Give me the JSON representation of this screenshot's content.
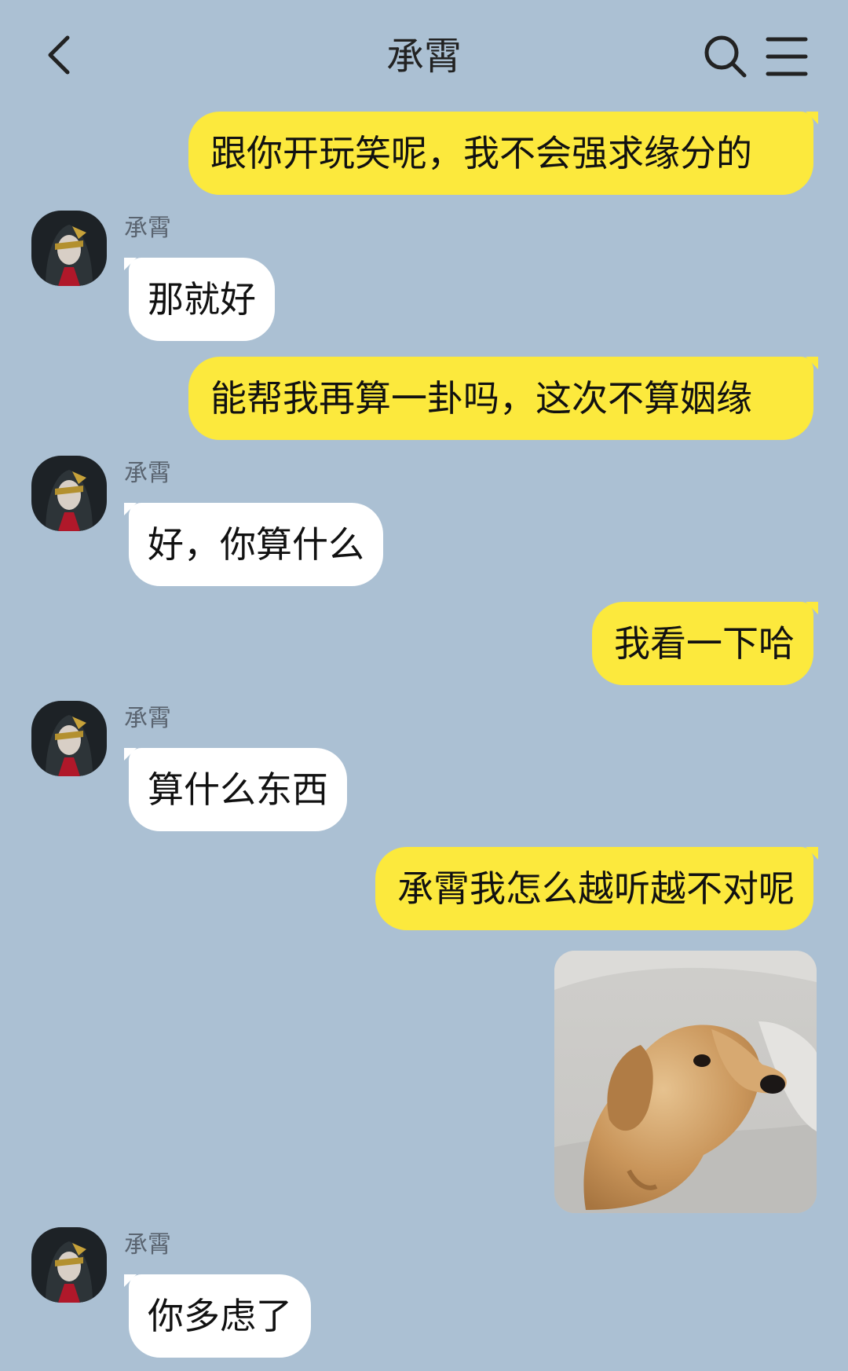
{
  "header": {
    "title": "承霄",
    "back_icon": "chevron-left-icon",
    "search_icon": "search-icon",
    "menu_icon": "menu-icon"
  },
  "colors": {
    "background": "#abc0d3",
    "outgoing_bubble": "#fce93d",
    "incoming_bubble": "#ffffff"
  },
  "messages": [
    {
      "direction": "out",
      "text": "跟你开玩笑呢，我不会强求缘分的"
    },
    {
      "direction": "in",
      "sender": "承霄",
      "text": "那就好"
    },
    {
      "direction": "out",
      "text": "能帮我再算一卦吗，这次不算姻缘"
    },
    {
      "direction": "in",
      "sender": "承霄",
      "text": "好，你算什么"
    },
    {
      "direction": "out",
      "text": "我看一下哈"
    },
    {
      "direction": "in",
      "sender": "承霄",
      "text": "算什么东西"
    },
    {
      "direction": "out",
      "text": "承霄我怎么越听越不对呢"
    },
    {
      "direction": "out",
      "type": "image",
      "image_icon": "dog-sticker-image"
    },
    {
      "direction": "in",
      "sender": "承霄",
      "text": "你多虑了"
    }
  ]
}
